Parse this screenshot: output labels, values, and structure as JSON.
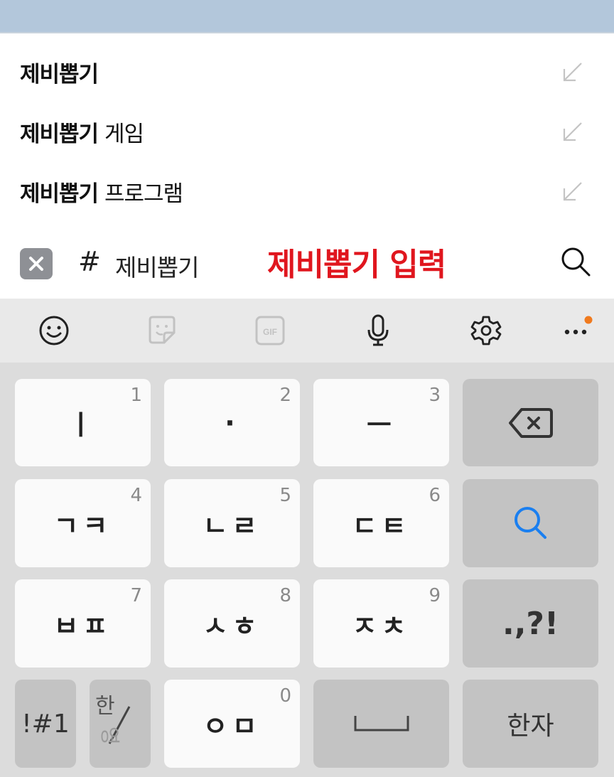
{
  "suggestions": [
    {
      "bold": "제비뽑기",
      "rest": "",
      "icon": "arrow-up-left-icon"
    },
    {
      "bold": "제비뽑기",
      "rest": " 게임",
      "icon": "arrow-up-left-icon"
    },
    {
      "bold": "제비뽑기",
      "rest": " 프로그램",
      "icon": "arrow-up-left-icon"
    }
  ],
  "search": {
    "hashtag": "#",
    "query": "제비뽑기",
    "annotation": "제비뽑기 입력",
    "annotation_color": "#e0161e"
  },
  "toolbar": {
    "icons": [
      "emoji-icon",
      "sticker-icon",
      "gif-icon",
      "microphone-icon",
      "settings-icon",
      "more-icon"
    ],
    "gif_label": "GIF",
    "notification_color": "#f07a1e"
  },
  "keyboard": {
    "rows": [
      [
        {
          "main": "ㅣ",
          "num": "1"
        },
        {
          "main": "·",
          "num": "2"
        },
        {
          "main": "ㅡ",
          "num": "3"
        }
      ],
      [
        {
          "main": "ㄱㅋ",
          "num": "4"
        },
        {
          "main": "ㄴㄹ",
          "num": "5"
        },
        {
          "main": "ㄷㅌ",
          "num": "6"
        }
      ],
      [
        {
          "main": "ㅂㅍ",
          "num": "7"
        },
        {
          "main": "ㅅㅎ",
          "num": "8"
        },
        {
          "main": "ㅈㅊ",
          "num": "9"
        }
      ]
    ],
    "punct": ".,?!",
    "symbols": "!#1",
    "lang_top": "한",
    "lang_bottom": "영",
    "zero_main": "ㅇㅁ",
    "zero_num": "0",
    "hanja": "한자",
    "search_key_color": "#1a7ff0"
  }
}
